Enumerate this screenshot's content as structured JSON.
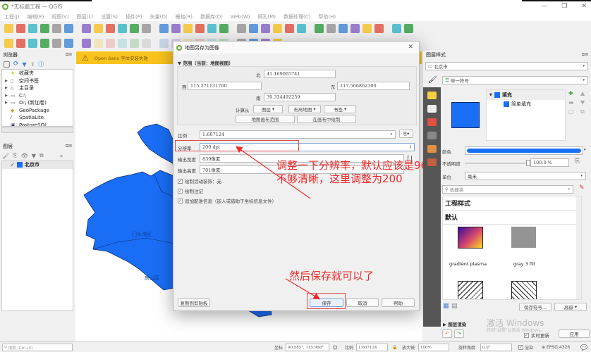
{
  "window": {
    "title": "*无标题工程 — QGIS"
  },
  "menu": [
    "工程(J)",
    "编辑(E)",
    "视图(V)",
    "图层(L)",
    "设置(S)",
    "插件(P)",
    "矢量(O)",
    "栅格(R)",
    "数据库(D)",
    "Web(W)",
    "网孔(M)",
    "数据处理(C)",
    "帮助(H)"
  ],
  "toolbar1": [
    "new-project-icon",
    "open-project-icon",
    "save-project-icon",
    "new-print-layout-icon",
    "layout-manager-icon",
    "style-manager-icon",
    "pan-icon",
    "pan-to-selection-icon",
    "zoom-in-icon",
    "zoom-out-icon",
    "zoom-full-icon",
    "zoom-to-selection-icon",
    "zoom-to-layer-icon",
    "zoom-native-icon",
    "zoom-last-icon",
    "zoom-next-icon",
    "new-bookmark-icon",
    "show-bookmarks-icon",
    "refresh-icon",
    "temporal-icon",
    "select-features-icon",
    "select-by-value-icon",
    "deselect-icon",
    "select-location-icon",
    "identify-icon",
    "attribute-table-icon",
    "processing-toolbox-icon",
    "statistics-icon",
    "open-field-calc-icon",
    "measure-icon",
    "map-tips-icon",
    "settings-icon"
  ],
  "toolbar2": [
    "add-data-source-icon",
    "new-geopackage-icon",
    "add-vector-icon",
    "add-spatialite-icon",
    "add-wms-icon",
    "add-raster-icon",
    "add-virtual-layer-icon",
    "current-edits-icon",
    "toggle-editing-icon",
    "save-edits-icon",
    "digitize-icon",
    "vertex-tool-icon",
    "delete-selected-icon",
    "cut-icon",
    "copy-icon",
    "paste-icon",
    "undo-icon",
    "redo-icon",
    "plugin-icon",
    "globe-icon",
    "python-icon",
    "help-icon"
  ],
  "browser": {
    "title": "浏览器",
    "items": [
      {
        "label": "收藏夹",
        "icon": "star-icon",
        "expand": false
      },
      {
        "label": "空间书签",
        "icon": "bookmark-icon",
        "expand": true
      },
      {
        "label": "主目录",
        "icon": "home-folder-icon",
        "expand": true
      },
      {
        "label": "C:\\",
        "icon": "folder-icon",
        "expand": true
      },
      {
        "label": "D:\\ (新加卷)",
        "icon": "folder-icon",
        "expand": true
      },
      {
        "label": "GeoPackage",
        "icon": "geopackage-icon",
        "expand": false
      },
      {
        "label": "SpatiaLite",
        "icon": "spatialite-icon",
        "expand": false
      },
      {
        "label": "PostgreSQL",
        "icon": "postgresql-icon",
        "expand": false
      }
    ]
  },
  "layers": {
    "title": "图层",
    "items": [
      {
        "label": "北京市",
        "checked": true,
        "color": "#1a6ef5"
      }
    ]
  },
  "warning": {
    "text": "Open Sans 字体安装失败"
  },
  "map": {
    "labels": [
      "门头沟区",
      "房山区"
    ],
    "fill": "#1a6ef5"
  },
  "dialog": {
    "title": "地图另存为图像",
    "extent_header": "范围（当前：地图视图）",
    "north_label": "北",
    "north": "41.169065741",
    "west_label": "西",
    "west": "115.371131700",
    "east_label": "东",
    "east": "117.566862300",
    "south_label": "南",
    "south": "39.334492259",
    "calc_from": "计算从",
    "btn_layer": "图层",
    "btn_layout": "布局地图",
    "btn_bookmark": "书签",
    "btn_canvas_extent": "地图画布范围",
    "btn_draw_canvas": "在画布中绘制",
    "scale_label": "比例",
    "scale": "1:607124",
    "resolution_label": "分辨率",
    "resolution": "200 dpi",
    "width_label": "输出宽度",
    "width": "839像素",
    "height_label": "输出高度",
    "height": "701像素",
    "chk_decorations": "绘制活动装饰：无",
    "chk_annotations": "绘制注记",
    "chk_georef": "追加配准信息（嵌入或借助于坐标信息文件）",
    "btn_copy": "复制到剪贴板",
    "btn_save": "保存",
    "btn_cancel": "取消",
    "btn_help": "帮助"
  },
  "annotations": {
    "note1_line1": "调整一下分辨率，默认应该是96，",
    "note1_line2": "不够清晰，这里调整为200",
    "note2": "然后保存就可以了",
    "color": "#ee2b2b"
  },
  "style_panel": {
    "title": "图层样式",
    "layer": "北京市",
    "renderer": "单一符号",
    "symbol_fill": "填充",
    "symbol_simple": "简单填充",
    "color_label": "颜色",
    "color": "#1a6ef5",
    "opacity_label": "不透明度",
    "opacity": "100.0 %",
    "opacity_value": 100,
    "unit_label": "单位",
    "unit": "毫米",
    "search_placeholder": "收藏夹",
    "section1": "工程样式",
    "section2": "默认",
    "symbols": [
      "gradient  plasma",
      "gray 3 fill"
    ],
    "btn_save_symbol": "保存符号...",
    "btn_advanced": "高级",
    "layer_render": "图层渲染",
    "live_update": "实时更新",
    "btn_apply": "应用",
    "watermark1": "激活 Windows",
    "watermark2": "转到\"设置\"以激活 Windows。"
  },
  "statusbar": {
    "search_placeholder": "搜索 (Ctrl+K)",
    "coord_label": "坐标",
    "coord": "40.585°, 115.968°",
    "scale_label": "比例",
    "scale": "1:607124",
    "magnifier_label": "放大镜",
    "magnifier": "100%",
    "rotation_label": "旋转角度",
    "rotation": "0.0°",
    "render_label": "渲染",
    "crs": "EPSG:4326"
  }
}
